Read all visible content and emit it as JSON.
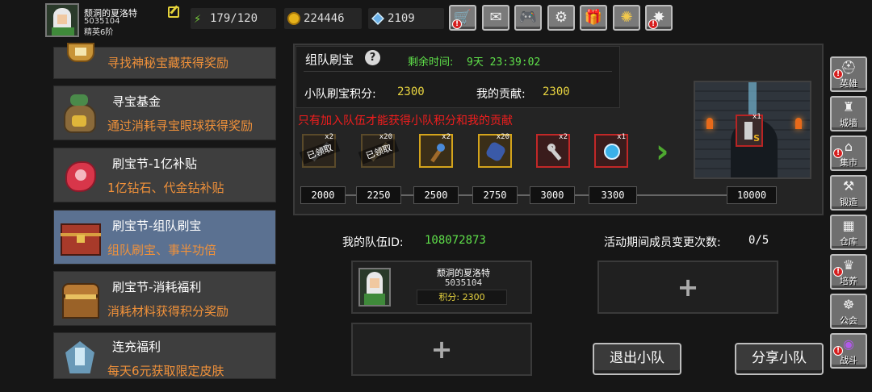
{
  "player": {
    "name": "颓洞的夏洛特",
    "id": "5035104",
    "rank": "精英6阶"
  },
  "resources": {
    "energy": "179/120",
    "gold": "224446",
    "gems": "2109"
  },
  "top_buttons": [
    "shop-icon",
    "mail-icon",
    "gamepad-icon",
    "gear-icon",
    "gift-icon",
    "colorwheel-icon",
    "fireworks-icon"
  ],
  "left_list": [
    {
      "title": "",
      "desc": "寻找神秘宝藏获得奖励"
    },
    {
      "title": "寻宝基金",
      "desc": "通过消耗寻宝眼球获得奖励"
    },
    {
      "title": "刷宝节-1亿补贴",
      "desc": "1亿钻石、代金钻补贴"
    },
    {
      "title": "刷宝节-组队刷宝",
      "desc": "组队刷宝、事半功倍"
    },
    {
      "title": "刷宝节-消耗福利",
      "desc": "消耗材料获得积分奖励"
    },
    {
      "title": "连充福利",
      "desc": "每天6元获取限定皮肤"
    }
  ],
  "event": {
    "title": "组队刷宝",
    "help": "?",
    "time_label": "剩余时间:",
    "time_value": "9天 23:39:02",
    "score_label": "小队刷宝积分:",
    "score_value": "2300",
    "contrib_label": "我的贡献:",
    "contrib_value": "2300",
    "warning": "只有加入队伍才能获得小队积分和我的贡献",
    "claimed_label": "已领取",
    "rewards": [
      {
        "count": "x2",
        "claimed": true
      },
      {
        "count": "x20",
        "claimed": true
      },
      {
        "count": "x2",
        "claimed": false
      },
      {
        "count": "x20",
        "claimed": false
      },
      {
        "count": "x2",
        "claimed": false
      },
      {
        "count": "x1",
        "claimed": false
      }
    ],
    "milestones": [
      "2000",
      "2250",
      "2500",
      "2750",
      "3000",
      "3300",
      "10000"
    ],
    "final_reward": {
      "count": "x1",
      "tag": "S"
    }
  },
  "team": {
    "id_label": "我的队伍ID:",
    "id_value": "108072873",
    "changes_label": "活动期间成员变更次数:",
    "changes_value": "0/5",
    "member": {
      "name": "颓洞的夏洛特",
      "id": "5035104",
      "score": "积分: 2300"
    },
    "plus": "+",
    "leave_button": "退出小队",
    "share_button": "分享小队"
  },
  "side_menu": [
    {
      "label": "英雄",
      "icon": "helmet-icon",
      "alert": true
    },
    {
      "label": "城墙",
      "icon": "castle-icon",
      "alert": false
    },
    {
      "label": "集市",
      "icon": "market-icon",
      "alert": true
    },
    {
      "label": "锻造",
      "icon": "anvil-icon",
      "alert": false
    },
    {
      "label": "仓库",
      "icon": "warehouse-icon",
      "alert": false
    },
    {
      "label": "培养",
      "icon": "trophy-icon",
      "alert": true
    },
    {
      "label": "公会",
      "icon": "guild-icon",
      "alert": false
    },
    {
      "label": "战斗",
      "icon": "portal-icon",
      "alert": true
    }
  ],
  "colors": {
    "accent_orange": "#f0913a",
    "green_text": "#5fe04a",
    "yellow_value": "#e8d440",
    "warning_red": "#f21d1d",
    "selected_item": "#5b7191"
  }
}
